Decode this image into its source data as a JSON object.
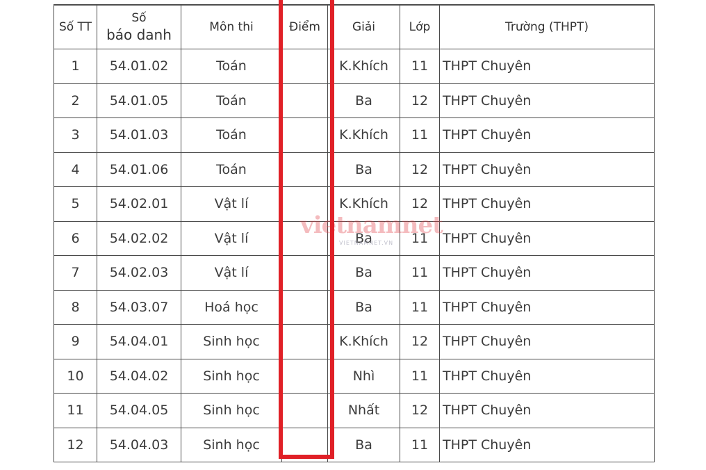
{
  "table": {
    "headers": [
      "Số TT",
      "Số báo danh",
      "Môn thi",
      "Điểm",
      "Giải",
      "Lớp",
      "Trường (THPT)"
    ],
    "header_sbd_line1": "Số",
    "header_sbd_line2": "báo danh",
    "rows": [
      {
        "stt": "1",
        "sbd": "54.01.02",
        "mon": "Toán",
        "diem": "",
        "giai": "K.Khích",
        "lop": "11",
        "truong": "THPT Chuyên"
      },
      {
        "stt": "2",
        "sbd": "54.01.05",
        "mon": "Toán",
        "diem": "",
        "giai": "Ba",
        "lop": "12",
        "truong": "THPT Chuyên"
      },
      {
        "stt": "3",
        "sbd": "54.01.03",
        "mon": "Toán",
        "diem": "",
        "giai": "K.Khích",
        "lop": "11",
        "truong": "THPT Chuyên"
      },
      {
        "stt": "4",
        "sbd": "54.01.06",
        "mon": "Toán",
        "diem": "",
        "giai": "Ba",
        "lop": "12",
        "truong": "THPT Chuyên"
      },
      {
        "stt": "5",
        "sbd": "54.02.01",
        "mon": "Vật lí",
        "diem": "",
        "giai": "K.Khích",
        "lop": "12",
        "truong": "THPT Chuyên"
      },
      {
        "stt": "6",
        "sbd": "54.02.02",
        "mon": "Vật lí",
        "diem": "",
        "giai": "Ba",
        "lop": "11",
        "truong": "THPT Chuyên"
      },
      {
        "stt": "7",
        "sbd": "54.02.03",
        "mon": "Vật lí",
        "diem": "",
        "giai": "Ba",
        "lop": "11",
        "truong": "THPT Chuyên"
      },
      {
        "stt": "8",
        "sbd": "54.03.07",
        "mon": "Hoá học",
        "diem": "",
        "giai": "Ba",
        "lop": "11",
        "truong": "THPT Chuyên"
      },
      {
        "stt": "9",
        "sbd": "54.04.01",
        "mon": "Sinh học",
        "diem": "",
        "giai": "K.Khích",
        "lop": "12",
        "truong": "THPT Chuyên"
      },
      {
        "stt": "10",
        "sbd": "54.04.02",
        "mon": "Sinh học",
        "diem": "",
        "giai": "Nhì",
        "lop": "11",
        "truong": "THPT Chuyên"
      },
      {
        "stt": "11",
        "sbd": "54.04.05",
        "mon": "Sinh học",
        "diem": "",
        "giai": "Nhất",
        "lop": "12",
        "truong": "THPT Chuyên"
      },
      {
        "stt": "12",
        "sbd": "54.04.03",
        "mon": "Sinh học",
        "diem": "",
        "giai": "Ba",
        "lop": "11",
        "truong": "THPT Chuyên"
      }
    ]
  },
  "highlight": {
    "color": "#e02027",
    "column": "Điểm"
  },
  "watermark": {
    "logo": "vietnamnet",
    "sub": "VIETNAMNET.VN"
  }
}
